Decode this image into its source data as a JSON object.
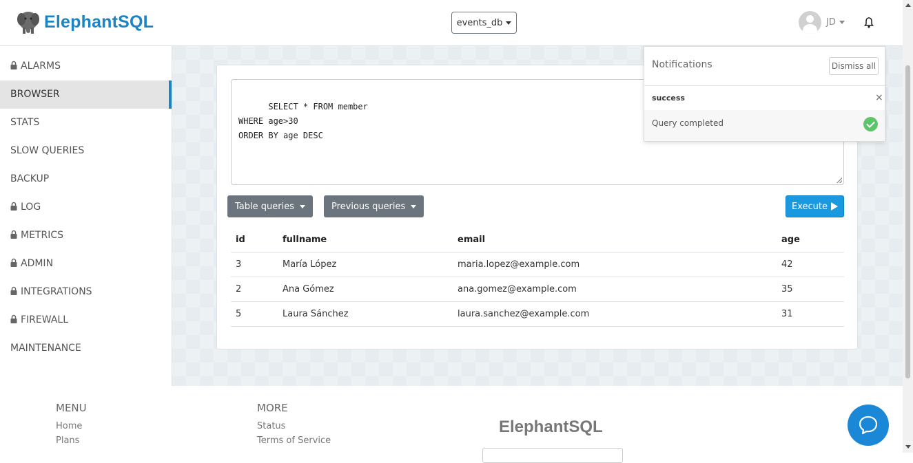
{
  "header": {
    "brand": "ElephantSQL",
    "db_select": "events_db",
    "user_initials": "JD"
  },
  "sidebar": {
    "items": [
      {
        "label": "ALARMS",
        "locked": true
      },
      {
        "label": "BROWSER",
        "locked": false,
        "active": true
      },
      {
        "label": "STATS",
        "locked": false
      },
      {
        "label": "SLOW QUERIES",
        "locked": false
      },
      {
        "label": "BACKUP",
        "locked": false
      },
      {
        "label": "LOG",
        "locked": true
      },
      {
        "label": "METRICS",
        "locked": true
      },
      {
        "label": "ADMIN",
        "locked": true
      },
      {
        "label": "INTEGRATIONS",
        "locked": true
      },
      {
        "label": "FIREWALL",
        "locked": true
      },
      {
        "label": "MAINTENANCE",
        "locked": false
      }
    ]
  },
  "main": {
    "query": "SELECT * FROM member\nWHERE age>30\nORDER BY age DESC",
    "table_queries_label": "Table queries",
    "previous_queries_label": "Previous queries",
    "execute_label": "Execute",
    "results": {
      "columns": [
        "id",
        "fullname",
        "email",
        "age"
      ],
      "rows": [
        [
          "3",
          "María López",
          "maria.lopez@example.com",
          "42"
        ],
        [
          "2",
          "Ana Gómez",
          "ana.gomez@example.com",
          "35"
        ],
        [
          "5",
          "Laura Sánchez",
          "laura.sanchez@example.com",
          "31"
        ]
      ]
    }
  },
  "notifications": {
    "title": "Notifications",
    "dismiss_label": "Dismiss all",
    "type": "success",
    "close": "×",
    "message": "Query completed"
  },
  "footer": {
    "menu_heading": "MENU",
    "menu_links": [
      "Home",
      "Plans"
    ],
    "more_heading": "MORE",
    "more_links": [
      "Status",
      "Terms of Service"
    ],
    "brand": "ElephantSQL"
  },
  "colors": {
    "brand": "#1a84c4",
    "execute": "#1a99e0",
    "secondary_button": "#6c757d",
    "success": "#5cc46a"
  }
}
